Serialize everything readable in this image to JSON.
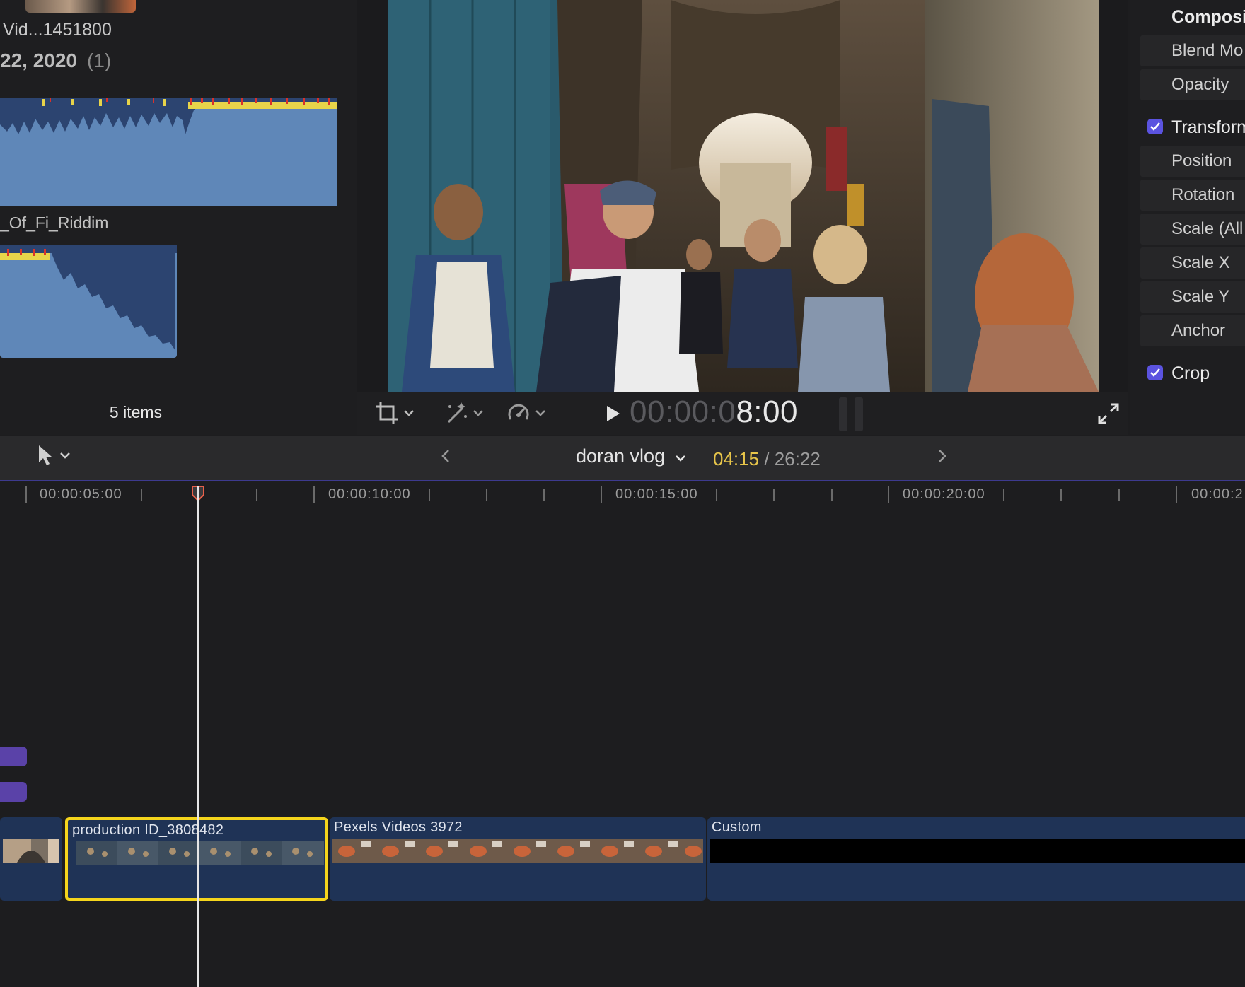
{
  "browser": {
    "clip_title": "Vid...1451800",
    "date_label": "22, 2020",
    "date_count": "(1)",
    "audio_clip_name": "_Of_Fi_Riddim",
    "items_count": "5 items"
  },
  "viewer": {
    "timecode_dim": "00:00:0",
    "timecode_lit": "8:00"
  },
  "inspector": {
    "section_compositing": "Composit",
    "blend_mode": "Blend Mo",
    "opacity": "Opacity",
    "section_transform": "Transform",
    "transform_checked": true,
    "position": "Position",
    "rotation": "Rotation",
    "scale_all": "Scale (All",
    "scale_x": "Scale X",
    "scale_y": "Scale Y",
    "anchor": "Anchor",
    "section_crop": "Crop",
    "crop_checked": true,
    "accent_color": "#5b53e0"
  },
  "timeline": {
    "project_name": "doran vlog",
    "current_duration": "04:15",
    "separator": "/",
    "total_duration": "26:22",
    "ruler_labels": [
      "00:00:05:00",
      "00:00:10:00",
      "00:00:15:00",
      "00:00:20:00",
      "00:00:2"
    ],
    "clips": [
      {
        "name": "production ID_3808482",
        "selected": true
      },
      {
        "name": "Pexels Videos 3972",
        "selected": false
      },
      {
        "name": "Custom",
        "selected": false
      }
    ],
    "selection_color": "#f5d51c",
    "clip_color": "#1f3356"
  }
}
